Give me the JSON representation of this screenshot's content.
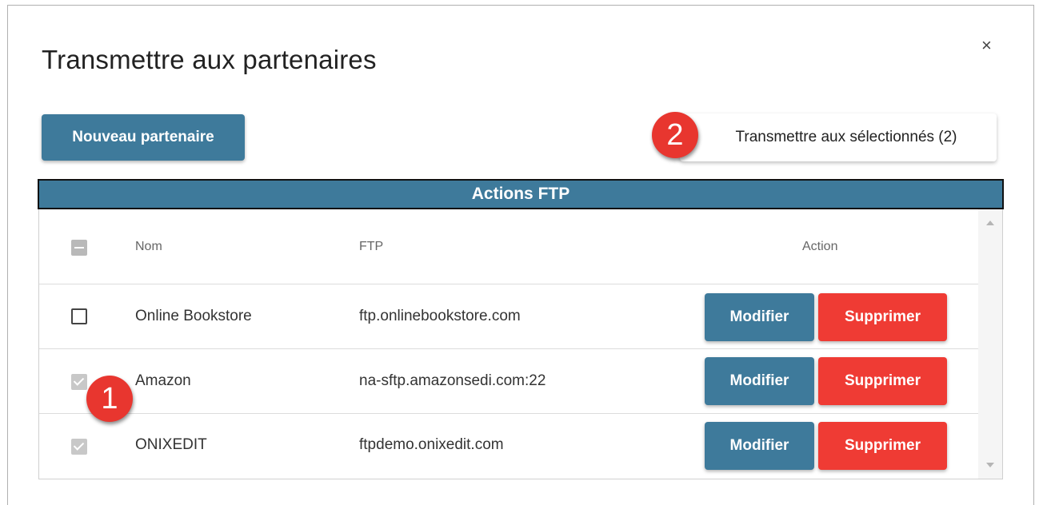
{
  "dialog": {
    "title": "Transmettre aux partenaires",
    "close_icon": "×"
  },
  "toolbar": {
    "new_partner_label": "Nouveau partenaire",
    "send_selected_label": "Transmettre aux sélectionnés (2)"
  },
  "annotations": {
    "badge1": "1",
    "badge2": "2"
  },
  "table": {
    "section_title": "Actions FTP",
    "columns": {
      "name": "Nom",
      "ftp": "FTP",
      "action": "Action"
    },
    "rows": [
      {
        "name": "Online Bookstore",
        "ftp": "ftp.onlinebookstore.com",
        "checked": false,
        "edit_label": "Modifier",
        "delete_label": "Supprimer"
      },
      {
        "name": "Amazon",
        "ftp": "na-sftp.amazonsedi.com:22",
        "checked": true,
        "edit_label": "Modifier",
        "delete_label": "Supprimer"
      },
      {
        "name": "ONIXEDIT",
        "ftp": "ftpdemo.onixedit.com",
        "checked": true,
        "edit_label": "Modifier",
        "delete_label": "Supprimer"
      }
    ]
  },
  "colors": {
    "primary": "#3e7a9b",
    "danger": "#ef3b34",
    "badge": "#e8362f"
  }
}
